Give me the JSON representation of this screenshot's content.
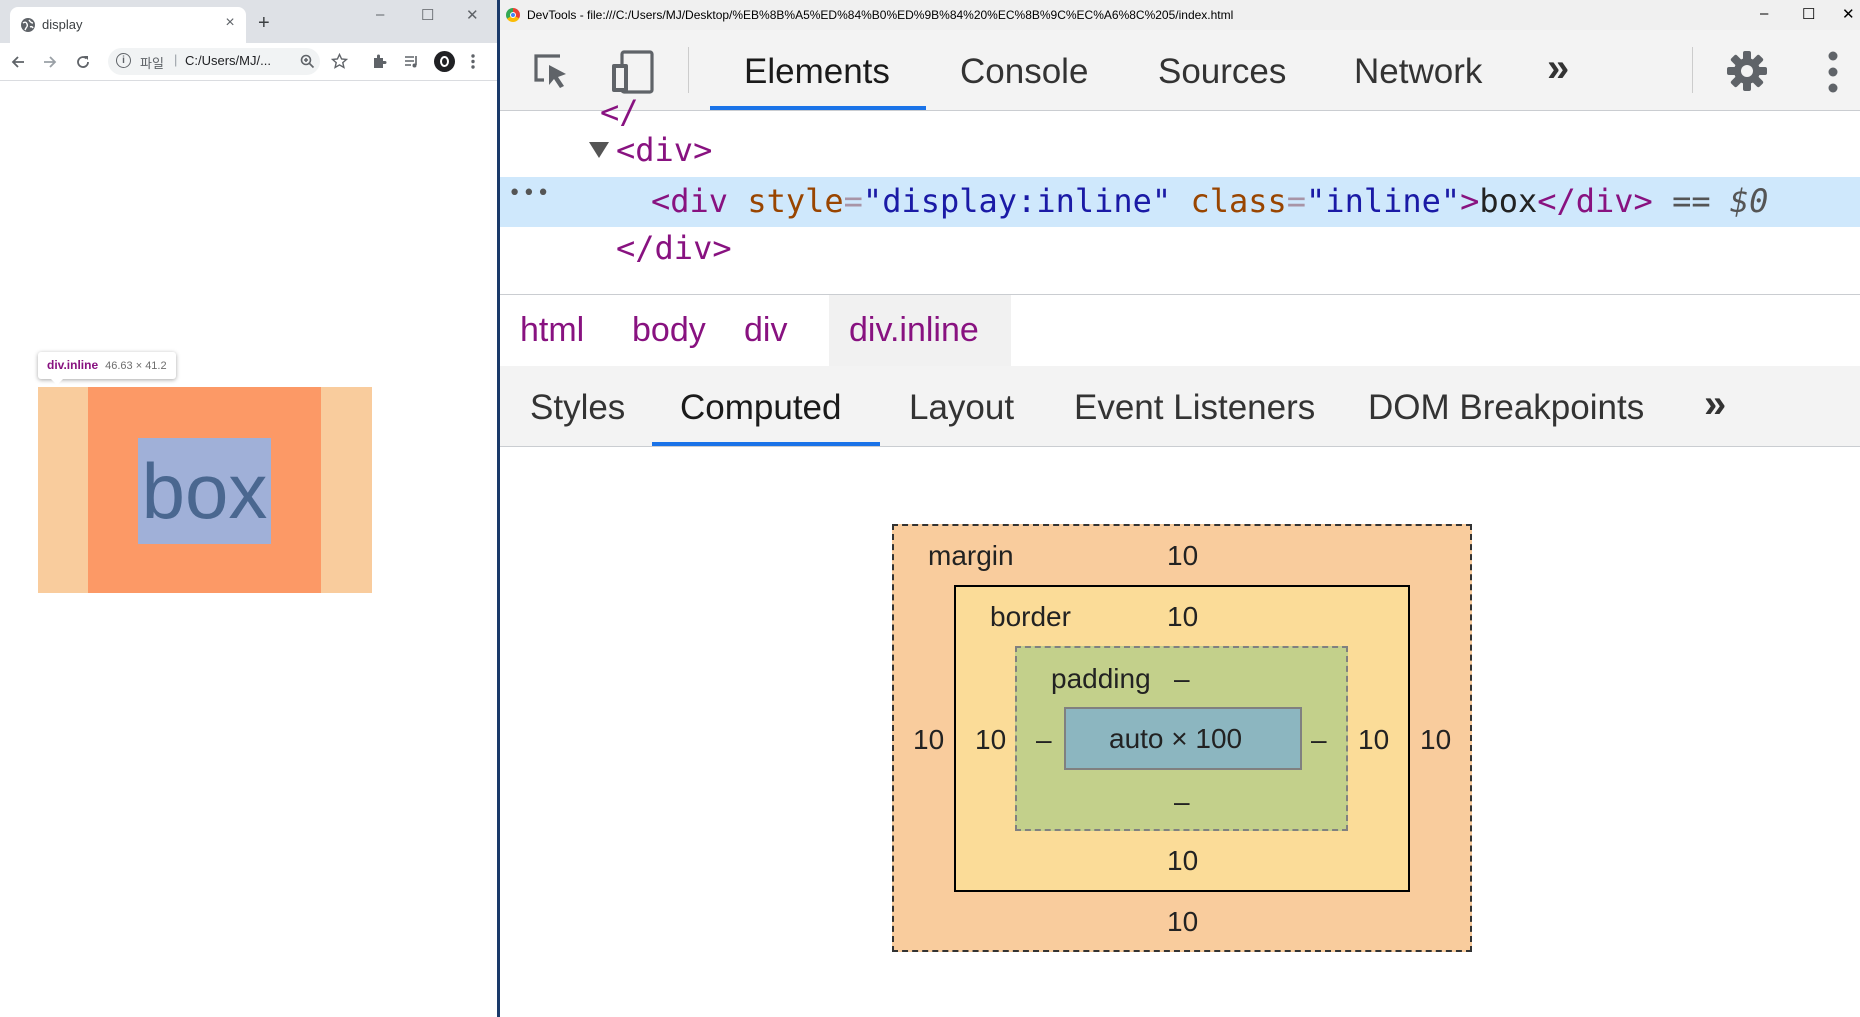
{
  "browser": {
    "tab_title": "display",
    "tab_close": "×",
    "new_tab": "+",
    "window_controls": [
      "–",
      "☐",
      "✕"
    ],
    "url_scheme": "파일",
    "url": "C:/Users/MJ/...",
    "highlighted_box_text": "box",
    "tooltip": {
      "tag": "div.inline",
      "dims": "46.63 × 41.2"
    }
  },
  "devtools": {
    "title": "DevTools - file:///C:/Users/MJ/Desktop/%EB%8B%A5%ED%84%B0%ED%9B%84%20%EC%8B%9C%EC%A6%8C%205/index.html",
    "window_controls": [
      "–",
      "☐",
      "✕"
    ],
    "tabs": [
      "Elements",
      "Console",
      "Sources",
      "Network"
    ],
    "active_tab": "Elements",
    "more": "»",
    "dom": {
      "line1_tag": "<div>",
      "sel_open": "<div",
      "attr1_name": "style",
      "attr1_value": "\"display:inline\"",
      "attr2_name": "class",
      "attr2_value": "\"inline\"",
      "sel_text": "box",
      "sel_close": "</div>",
      "sel_suffix": "== $0",
      "line3_tag": "</div>",
      "dots": "•••"
    },
    "breadcrumbs": [
      "html",
      "body",
      "div",
      "div.inline"
    ],
    "subtabs": [
      "Styles",
      "Computed",
      "Layout",
      "Event Listeners",
      "DOM Breakpoints"
    ],
    "active_subtab": "Computed",
    "box_model": {
      "margin_label": "margin",
      "margin_top": "10",
      "margin_bottom": "10",
      "margin_left": "10",
      "margin_right": "10",
      "border_label": "border",
      "border_top": "10",
      "border_bottom": "10",
      "border_left": "10",
      "border_right": "10",
      "padding_label": "padding",
      "padding_top": "–",
      "padding_bottom": "–",
      "padding_left": "–",
      "padding_right": "–",
      "content": "auto × 100"
    }
  },
  "colors": {
    "accent": "#1a73e8",
    "tag": "#881280",
    "attr_name": "#994500",
    "attr_value": "#1a1aa6",
    "margin": "#f9cc9d",
    "border": "#fbdc98",
    "padding": "#c3d08b",
    "content": "#8cb6c0",
    "selected_row": "#cfe8fc"
  },
  "icons": [
    "globe-icon",
    "back-icon",
    "forward-icon",
    "reload-icon",
    "info-icon",
    "zoom-icon",
    "star-icon",
    "extensions-icon",
    "media-icon",
    "profile-icon",
    "menu-icon",
    "inspect-icon",
    "device-icon",
    "settings-icon",
    "kebab-icon"
  ]
}
